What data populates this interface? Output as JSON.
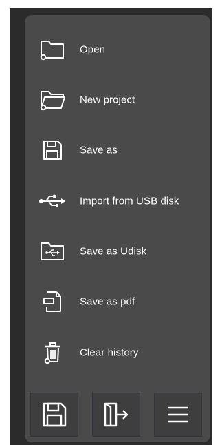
{
  "menu": {
    "items": [
      {
        "label": "Open",
        "icon": "folder-open-icon"
      },
      {
        "label": "New project",
        "icon": "folder-new-icon"
      },
      {
        "label": "Save as",
        "icon": "floppy-icon"
      },
      {
        "label": "Import from USB disk",
        "icon": "usb-icon"
      },
      {
        "label": "Save as Udisk",
        "icon": "folder-usb-icon"
      },
      {
        "label": "Save as pdf",
        "icon": "pdf-file-icon"
      },
      {
        "label": "Clear history",
        "icon": "trash-icon"
      }
    ]
  },
  "toolbar": {
    "buttons": [
      {
        "icon": "floppy-icon"
      },
      {
        "icon": "exit-icon"
      },
      {
        "icon": "hamburger-menu-icon"
      }
    ]
  },
  "colors": {
    "panel": "#4a4a4a",
    "frame": "#2b2b2b",
    "text": "#ffffff"
  }
}
